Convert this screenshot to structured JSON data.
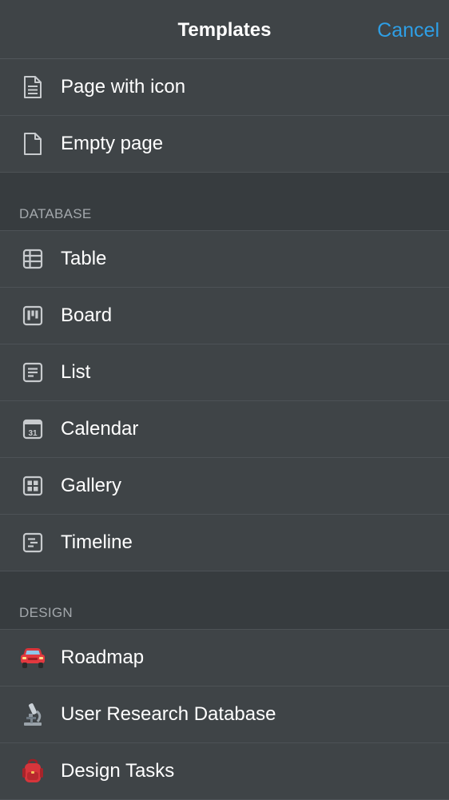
{
  "header": {
    "title": "Templates",
    "cancel_label": "Cancel"
  },
  "basic_items": [
    {
      "label": "Page with icon",
      "icon": "page-with-icon-icon"
    },
    {
      "label": "Empty page",
      "icon": "empty-page-icon"
    }
  ],
  "database_section": {
    "title": "DATABASE",
    "items": [
      {
        "label": "Table",
        "icon": "table-icon"
      },
      {
        "label": "Board",
        "icon": "board-icon"
      },
      {
        "label": "List",
        "icon": "list-icon"
      },
      {
        "label": "Calendar",
        "icon": "calendar-icon",
        "icon_text": "31"
      },
      {
        "label": "Gallery",
        "icon": "gallery-icon"
      },
      {
        "label": "Timeline",
        "icon": "timeline-icon"
      }
    ]
  },
  "design_section": {
    "title": "DESIGN",
    "items": [
      {
        "label": "Roadmap",
        "icon": "car-emoji-icon"
      },
      {
        "label": "User Research Database",
        "icon": "microscope-emoji-icon"
      },
      {
        "label": "Design Tasks",
        "icon": "backpack-emoji-icon"
      }
    ]
  },
  "colors": {
    "background": "#373c3f",
    "row_background": "#3f4447",
    "accent": "#2e9fe6",
    "section_text": "#a3a8ac"
  }
}
